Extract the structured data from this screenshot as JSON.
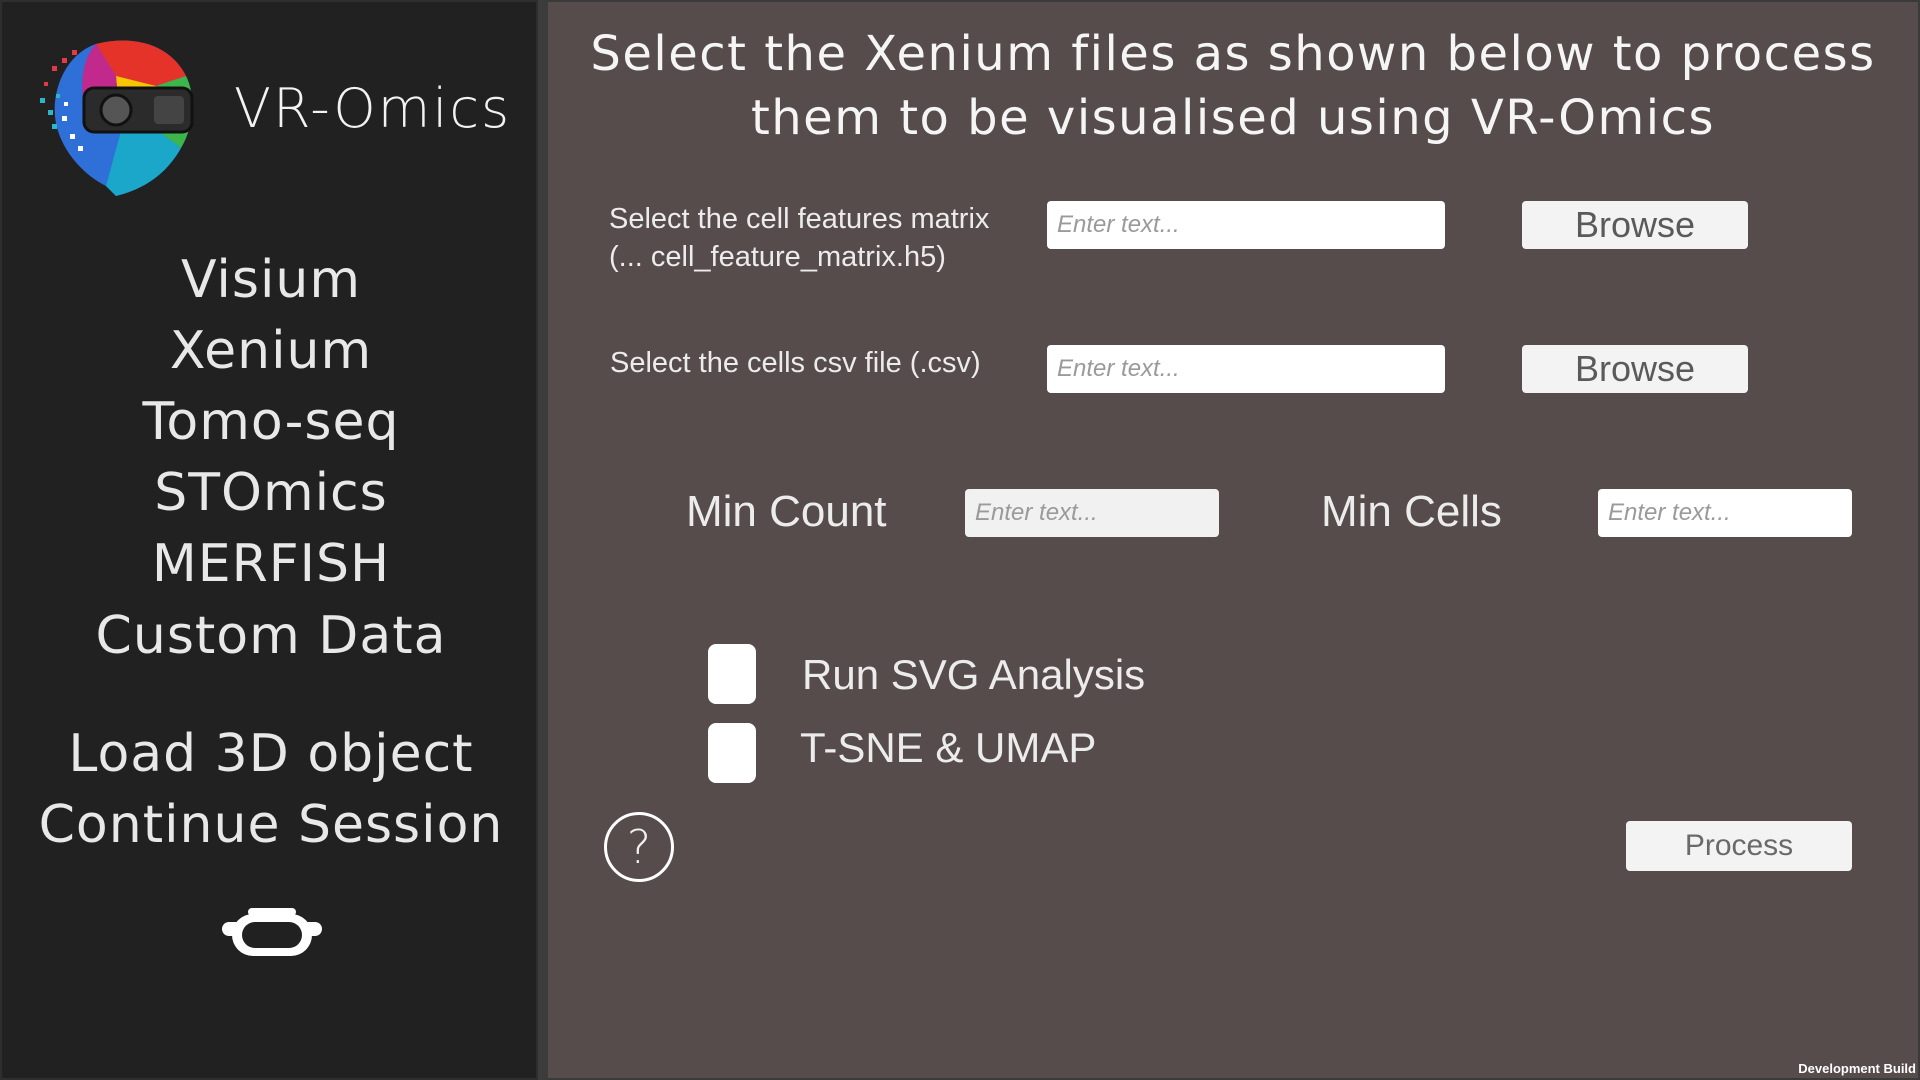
{
  "app": {
    "title": "VR-Omics"
  },
  "sidebar": {
    "items": [
      {
        "label": "Visium"
      },
      {
        "label": "Xenium"
      },
      {
        "label": "Tomo-seq"
      },
      {
        "label": "STOmics"
      },
      {
        "label": "MERFISH"
      },
      {
        "label": "Custom Data"
      },
      {
        "label": "Load 3D object"
      },
      {
        "label": "Continue Session"
      }
    ],
    "vr_icon": "vr-headset-icon"
  },
  "main": {
    "heading": "Select the Xenium files as shown below to process them to be visualised using VR-Omics",
    "file_rows": [
      {
        "label": "Select the cell features matrix (... cell_feature_matrix.h5)",
        "placeholder": "Enter text...",
        "button": "Browse"
      },
      {
        "label": "Select the cells csv file (.csv)",
        "placeholder": "Enter text...",
        "button": "Browse"
      }
    ],
    "params": {
      "min_count_label": "Min Count",
      "min_count_placeholder": "Enter text...",
      "min_cells_label": "Min Cells",
      "min_cells_placeholder": "Enter text..."
    },
    "options": [
      {
        "label": "Run SVG Analysis",
        "checked": false
      },
      {
        "label": "T-SNE & UMAP",
        "checked": false
      }
    ],
    "help_symbol": "?",
    "process_button": "Process"
  },
  "footer": {
    "build_label": "Development Build"
  }
}
